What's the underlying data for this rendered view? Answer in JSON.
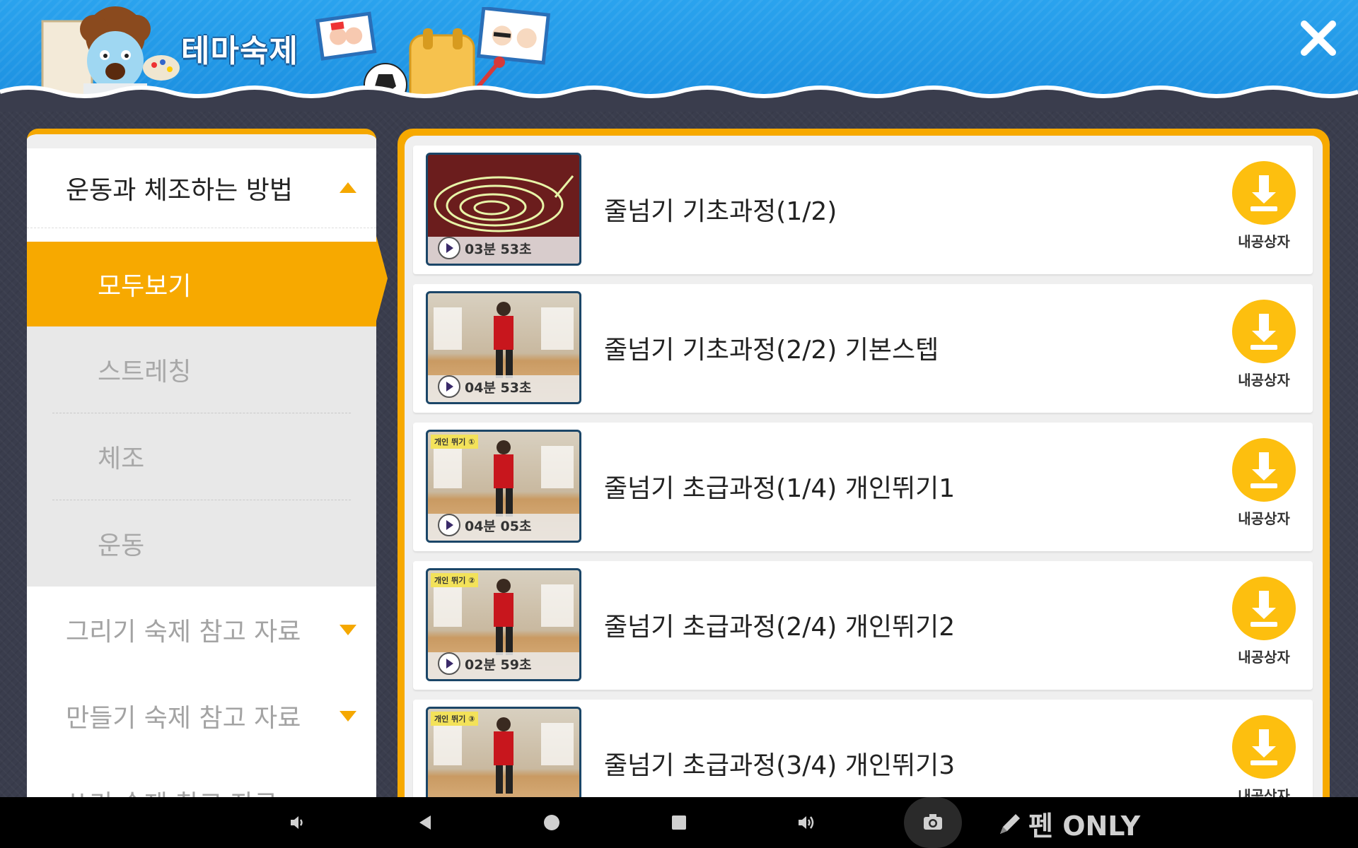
{
  "header": {
    "title": "테마숙제",
    "close_icon": "close-icon"
  },
  "sidebar": {
    "open_category": {
      "label": "운동과 체조하는 방법",
      "expanded": true
    },
    "active_sub": "모두보기",
    "sub_items": [
      {
        "label": "스트레칭"
      },
      {
        "label": "체조"
      },
      {
        "label": "운동"
      }
    ],
    "closed_categories": [
      {
        "label": "그리기 숙제 참고 자료"
      },
      {
        "label": "만들기 숙제 참고 자료"
      },
      {
        "label": "쓰기 숙제 참고 자료"
      }
    ]
  },
  "videos": [
    {
      "title": "줄넘기 기초과정(1/2)",
      "duration": "03분 53초",
      "badge": "",
      "download_label": "내공상자"
    },
    {
      "title": "줄넘기 기초과정(2/2) 기본스텝",
      "duration": "04분 53초",
      "badge": "",
      "download_label": "내공상자"
    },
    {
      "title": "줄넘기 초급과정(1/4) 개인뛰기1",
      "duration": "04분 05초",
      "badge": "개인 뛰기 ①",
      "download_label": "내공상자"
    },
    {
      "title": "줄넘기 초급과정(2/4) 개인뛰기2",
      "duration": "02분 59초",
      "badge": "개인 뛰기 ②",
      "download_label": "내공상자"
    },
    {
      "title": "줄넘기 초급과정(3/4) 개인뛰기3",
      "duration": "",
      "badge": "개인 뛰기 ③",
      "download_label": "내공상자"
    }
  ],
  "navbar": {
    "pen_only_label": "펜 ONLY"
  },
  "colors": {
    "accent": "#f7a900",
    "header_blue": "#1f97e6",
    "download_yellow": "#fdbf0f",
    "thumb_border": "#1b4668"
  }
}
